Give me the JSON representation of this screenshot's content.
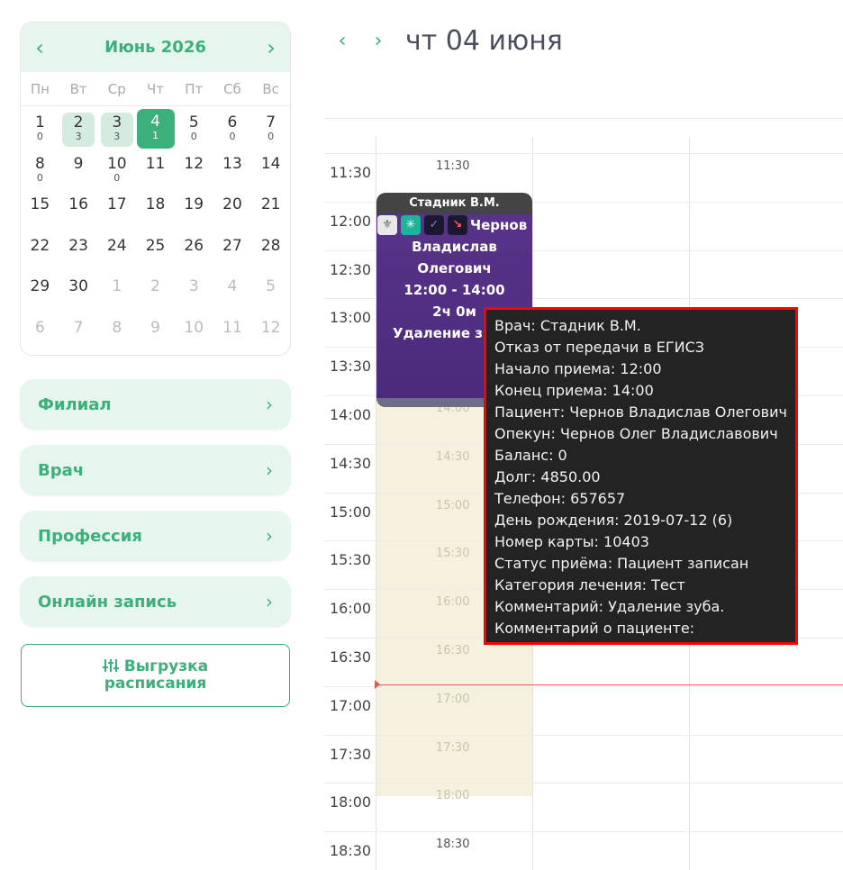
{
  "mini_calendar": {
    "title": "Июнь 2026",
    "prev_icon": "‹",
    "next_icon": "›",
    "weekdays": [
      "Пн",
      "Вт",
      "Ср",
      "Чт",
      "Пт",
      "Сб",
      "Вс"
    ],
    "weeks": [
      [
        {
          "n": "1",
          "c": "0"
        },
        {
          "n": "2",
          "c": "3",
          "has": true
        },
        {
          "n": "3",
          "c": "3",
          "has": true
        },
        {
          "n": "4",
          "c": "1",
          "today": true
        },
        {
          "n": "5",
          "c": "0"
        },
        {
          "n": "6",
          "c": "0"
        },
        {
          "n": "7",
          "c": "0"
        }
      ],
      [
        {
          "n": "8",
          "c": "0"
        },
        {
          "n": "9"
        },
        {
          "n": "10",
          "c": "0"
        },
        {
          "n": "11"
        },
        {
          "n": "12"
        },
        {
          "n": "13"
        },
        {
          "n": "14"
        }
      ],
      [
        {
          "n": "15"
        },
        {
          "n": "16"
        },
        {
          "n": "17"
        },
        {
          "n": "18"
        },
        {
          "n": "19"
        },
        {
          "n": "20"
        },
        {
          "n": "21"
        }
      ],
      [
        {
          "n": "22"
        },
        {
          "n": "23"
        },
        {
          "n": "24"
        },
        {
          "n": "25"
        },
        {
          "n": "26"
        },
        {
          "n": "27"
        },
        {
          "n": "28"
        }
      ],
      [
        {
          "n": "29"
        },
        {
          "n": "30"
        },
        {
          "n": "1",
          "other": true
        },
        {
          "n": "2",
          "other": true
        },
        {
          "n": "3",
          "other": true
        },
        {
          "n": "4",
          "other": true
        },
        {
          "n": "5",
          "other": true
        }
      ],
      [
        {
          "n": "6",
          "other": true
        },
        {
          "n": "7",
          "other": true
        },
        {
          "n": "8",
          "other": true
        },
        {
          "n": "9",
          "other": true
        },
        {
          "n": "10",
          "other": true
        },
        {
          "n": "11",
          "other": true
        },
        {
          "n": "12",
          "other": true
        }
      ]
    ]
  },
  "filters": {
    "branch": "Филиал",
    "doctor": "Врач",
    "profession": "Профессия",
    "online": "Онлайн запись",
    "chevron": "›"
  },
  "export_button": {
    "line1": "Выгрузка",
    "line2": "расписания",
    "icon": "sliders-icon"
  },
  "header": {
    "prev": "‹",
    "next": "›",
    "date": "чт 04 июня"
  },
  "time_labels": [
    "11:30",
    "12:00",
    "12:30",
    "13:00",
    "13:30",
    "14:00",
    "14:30",
    "15:00",
    "15:30",
    "16:00",
    "16:30",
    "17:00",
    "17:30",
    "18:00",
    "18:30"
  ],
  "hover_labels": [
    "11:30",
    "14:00",
    "14:30",
    "15:00",
    "15:30",
    "16:00",
    "16:30",
    "17:00",
    "17:30",
    "18:00",
    "18:30"
  ],
  "appointment": {
    "doctor": "Стадник В.М.",
    "name_first_line": "Чернов",
    "name_line2": "Владислав",
    "name_line3": "Олегович",
    "time": "12:00 - 14:00",
    "duration": "2ч 0м",
    "comment": "Удаление з",
    "icons": [
      "emblem-icon",
      "asterisk-icon",
      "check-icon",
      "trend-down-icon"
    ]
  },
  "tooltip": {
    "lines": [
      "Врач: Стадник В.М.",
      "Отказ от передачи в ЕГИСЗ",
      "Начало приема: 12:00",
      "Конец приема: 14:00",
      "Пациент: Чернов Владислав Олегович",
      "Опекун: Чернов Олег Владиславович",
      "Баланс: 0",
      "Долг: 4850.00",
      "Телефон: 657657",
      "День рождения: 2019-07-12 (6)",
      "Номер карты: 10403",
      "Статус приёма: Пациент записан",
      "Категория лечения: Тест",
      "Комментарий: Удаление зуба.",
      "Комментарий о пациенте:"
    ]
  },
  "colors": {
    "accent": "#3bb07a",
    "appointment": "#4f2d80",
    "now_line": "#e05a50",
    "tooltip_border": "#ff0000"
  }
}
